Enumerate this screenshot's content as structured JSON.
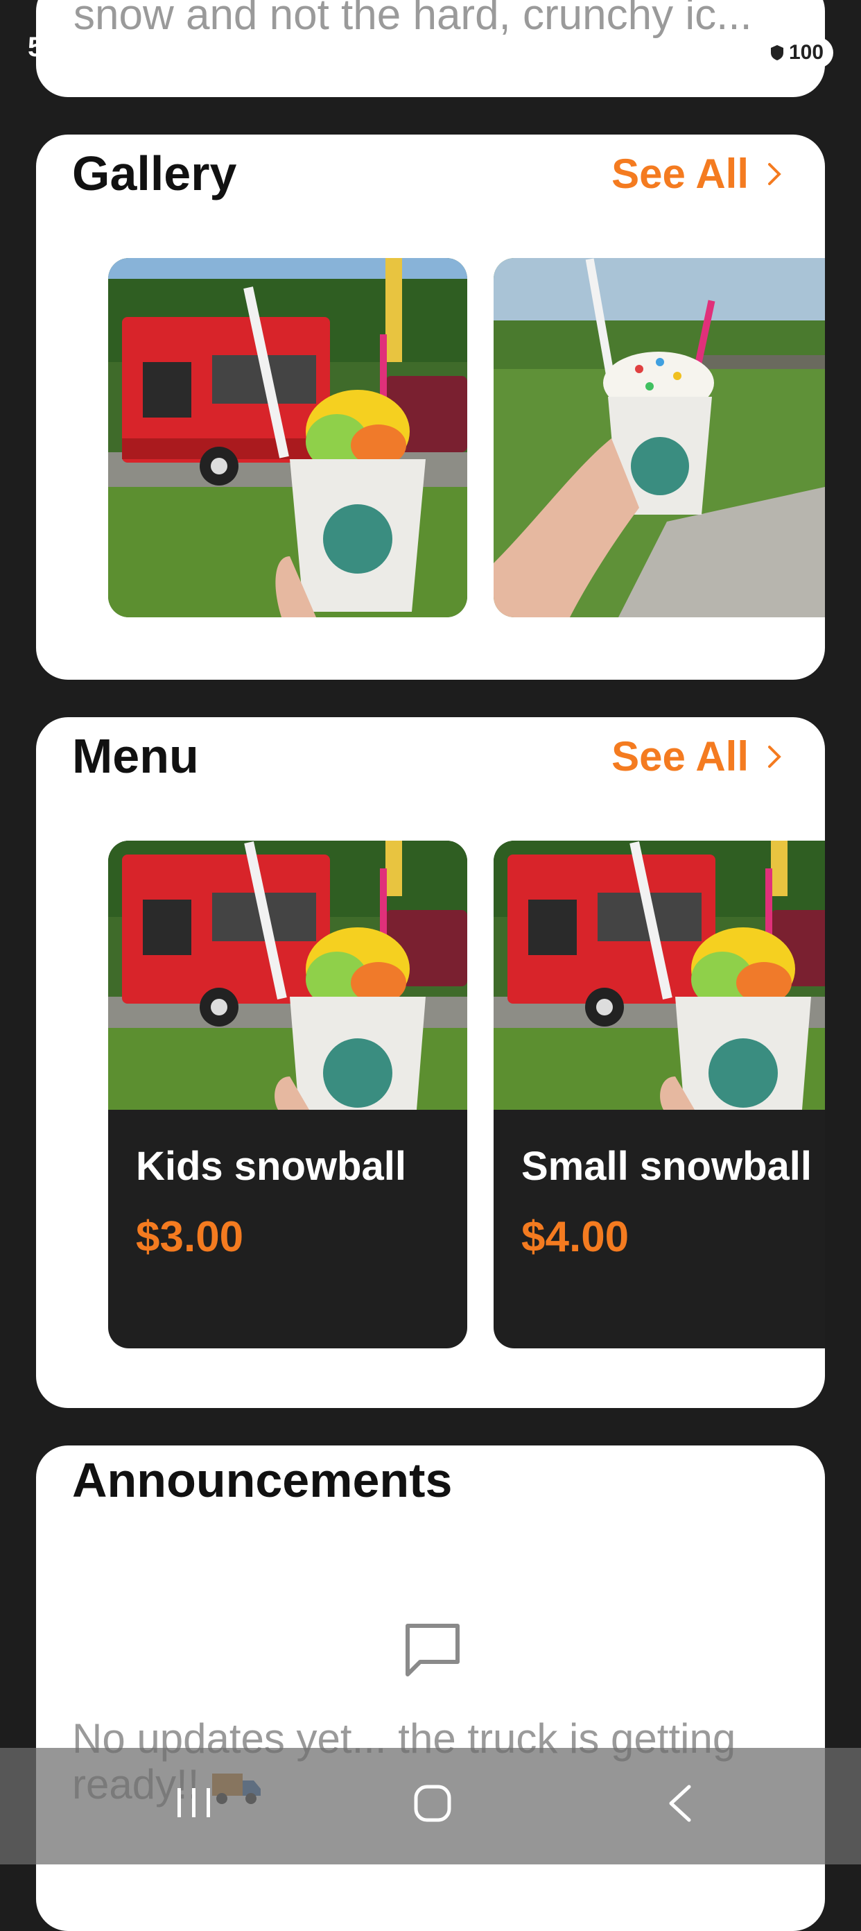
{
  "status_bar": {
    "time_fragment": "5",
    "battery": "100"
  },
  "top_card": {
    "snippet": "snow and not the hard, crunchy ic..."
  },
  "gallery": {
    "title": "Gallery",
    "see_all": "See All",
    "images": [
      {
        "icon": "snowball-truck-photo"
      },
      {
        "icon": "milkshake-photo"
      }
    ]
  },
  "menu": {
    "title": "Menu",
    "see_all": "See All",
    "items": [
      {
        "name": "Kids snowball",
        "price": "$3.00"
      },
      {
        "name": "Small snowball",
        "price": "$4.00"
      }
    ]
  },
  "announcements": {
    "title": "Announcements",
    "empty_text": "No updates yet... the truck is getting ready!!"
  },
  "nav": {
    "items": [
      "recents",
      "home",
      "back"
    ]
  },
  "colors": {
    "accent": "#f47b20",
    "background": "#1d1d1d",
    "card": "#ffffff"
  }
}
